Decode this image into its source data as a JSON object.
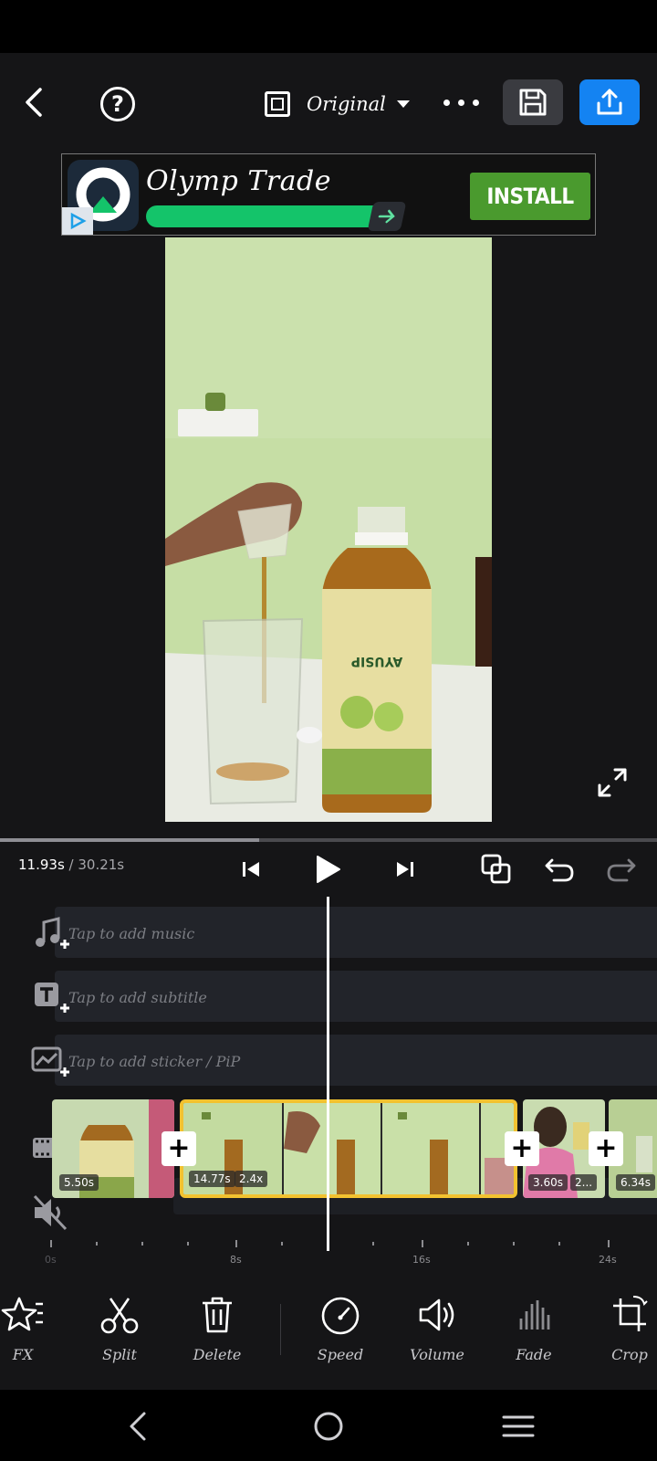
{
  "topbar": {
    "aspect_label": "Original",
    "icons": [
      "back-arrow-icon",
      "help-icon",
      "aspect-ratio-icon",
      "more-icon",
      "save-icon",
      "export-icon"
    ]
  },
  "ad": {
    "title": "Olymp Trade",
    "install_label": "INSTALL",
    "accent": "#14c46a",
    "button_color": "#4a9a2e"
  },
  "player": {
    "current_time": "11.93s",
    "total_time": "/ 30.21s",
    "progress": 0.395
  },
  "tracks": {
    "music": "Tap to add music",
    "subtitle": "Tap to add subtitle",
    "sticker": "Tap to add sticker / PiP"
  },
  "clips": [
    {
      "duration": "5.50s"
    },
    {
      "duration": "14.77s",
      "speed": "2.4x",
      "selected": true
    },
    {
      "duration": "3.60s",
      "speed": "2..."
    },
    {
      "duration": "6.34s"
    }
  ],
  "ruler": {
    "labels": [
      "0s",
      "8s",
      "16s",
      "24s"
    ]
  },
  "toolbar": {
    "fx": "FX",
    "split": "Split",
    "delete": "Delete",
    "speed": "Speed",
    "volume": "Volume",
    "fade": "Fade",
    "crop": "Crop"
  },
  "colors": {
    "background": "#151517",
    "export_blue": "#1483f2",
    "selection_yellow": "#f2c230"
  }
}
